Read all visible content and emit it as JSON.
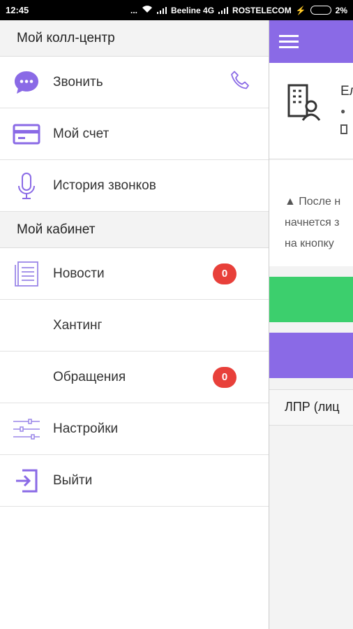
{
  "status_bar": {
    "time": "12:45",
    "dots": "...",
    "carrier1": "Beeline 4G",
    "carrier2": "ROSTELECOM",
    "battery": "2%"
  },
  "drawer": {
    "section1": "Мой колл-центр",
    "items1": [
      {
        "label": "Звонить",
        "icon": "chat-bubble-icon"
      },
      {
        "label": "Мой счет",
        "icon": "credit-card-icon"
      },
      {
        "label": "История звонков",
        "icon": "microphone-icon"
      }
    ],
    "section2": "Мой кабинет",
    "items2": [
      {
        "label": "Новости",
        "icon": "document-icon",
        "badge": "0"
      },
      {
        "label": "Хантинг"
      },
      {
        "label": "Обращения",
        "badge": "0"
      },
      {
        "label": "Настройки",
        "icon": "sliders-icon"
      },
      {
        "label": "Выйти",
        "icon": "logout-icon"
      }
    ]
  },
  "background_app": {
    "card_title": "Ел",
    "warning_lines": [
      "▲ После н",
      "начнется з",
      "на кнопку"
    ],
    "lpr_label": "ЛПР (лиц"
  },
  "colors": {
    "accent": "#8a6ae6",
    "green": "#3ccf6d",
    "badge": "#e8403a"
  }
}
